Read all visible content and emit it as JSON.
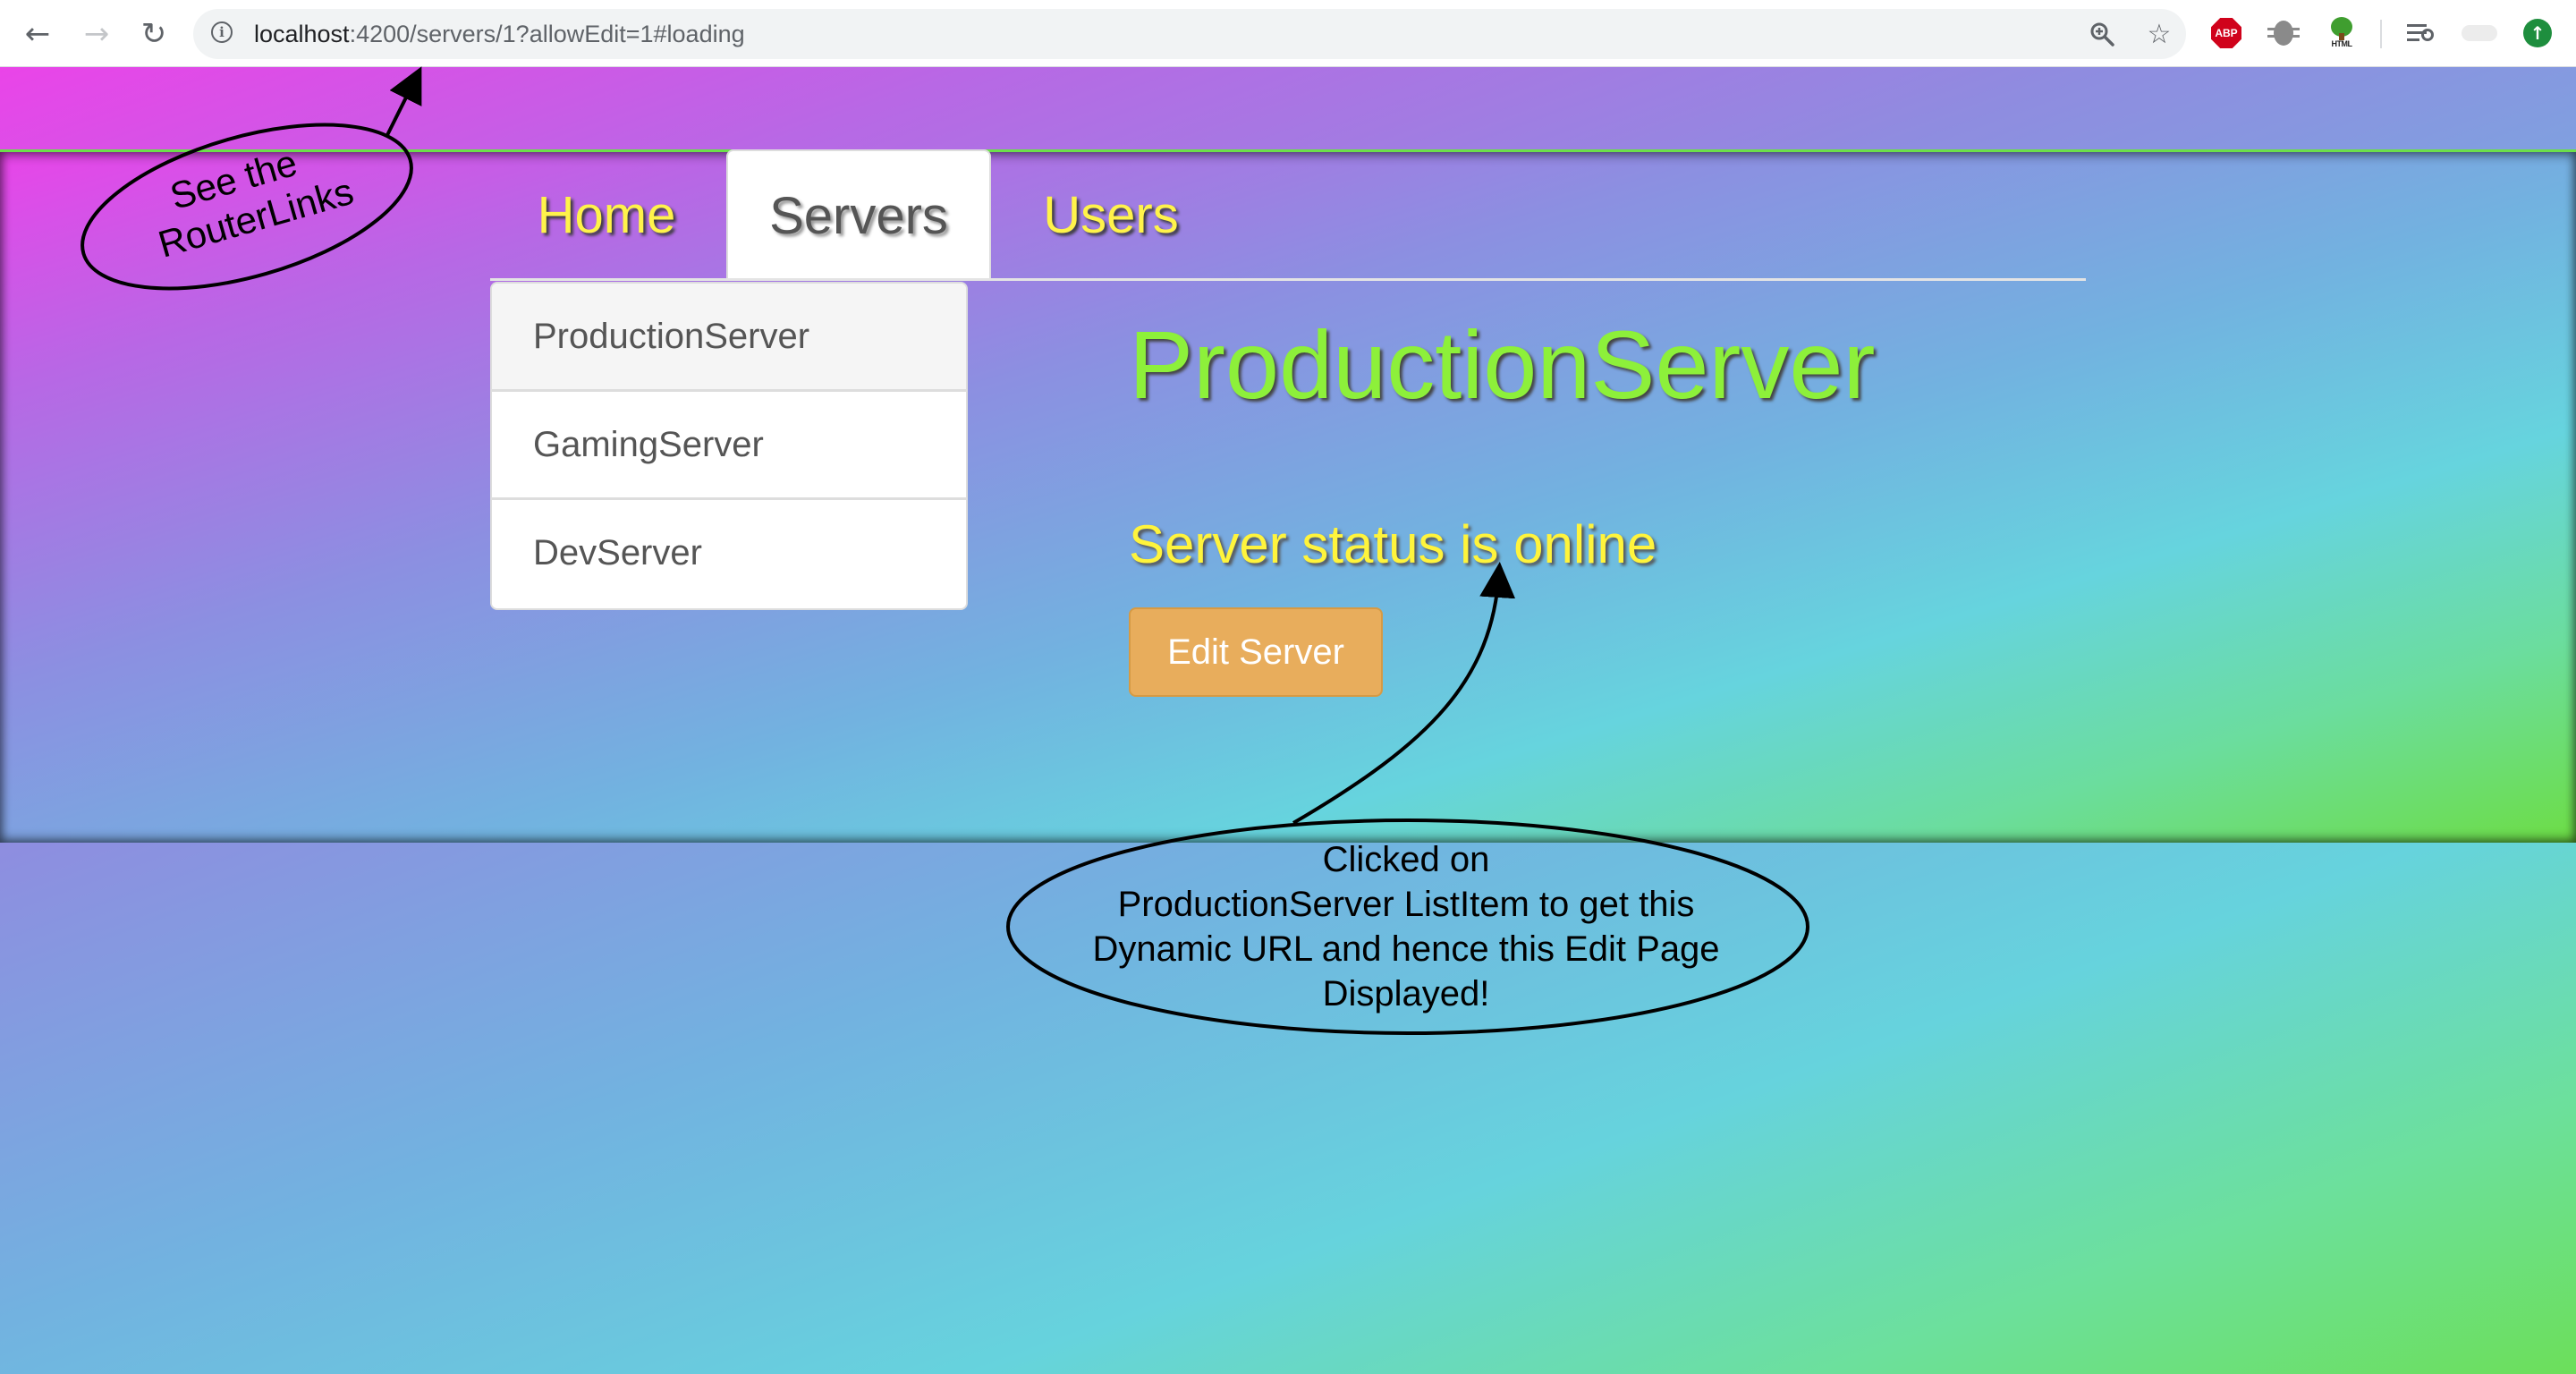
{
  "browser": {
    "url_host": "localhost",
    "url_rest": ":4200/servers/1?allowEdit=1#loading",
    "icons": {
      "back": "back-arrow-icon",
      "forward": "forward-arrow-icon",
      "reload": "reload-icon",
      "info": "info-icon",
      "zoom": "zoom-icon",
      "bookmark": "star-icon"
    },
    "extensions": {
      "adblock_label": "ABP",
      "tree_label": "HTML"
    }
  },
  "nav": {
    "tabs": [
      {
        "label": "Home"
      },
      {
        "label": "Servers"
      },
      {
        "label": "Users"
      }
    ],
    "active_tab": "Servers"
  },
  "servers": {
    "list": [
      {
        "name": "ProductionServer"
      },
      {
        "name": "GamingServer"
      },
      {
        "name": "DevServer"
      }
    ],
    "active_index": 0
  },
  "detail": {
    "name": "ProductionServer",
    "status": "Server status is online",
    "edit_label": "Edit Server"
  },
  "annotations": {
    "router_links": "See the\nRouterLinks",
    "clicked_note": "Clicked on\nProductionServer ListItem to get this\nDynamic URL and hence this Edit Page\nDisplayed!"
  },
  "colors": {
    "tab_text": "#fff34a",
    "server_name": "#8df03a",
    "server_status": "#fff43c",
    "edit_button": "#e8ad5c",
    "gradient_start": "#ea44e8",
    "gradient_mid": "#66d3dd",
    "gradient_end": "#6cdf5a"
  }
}
